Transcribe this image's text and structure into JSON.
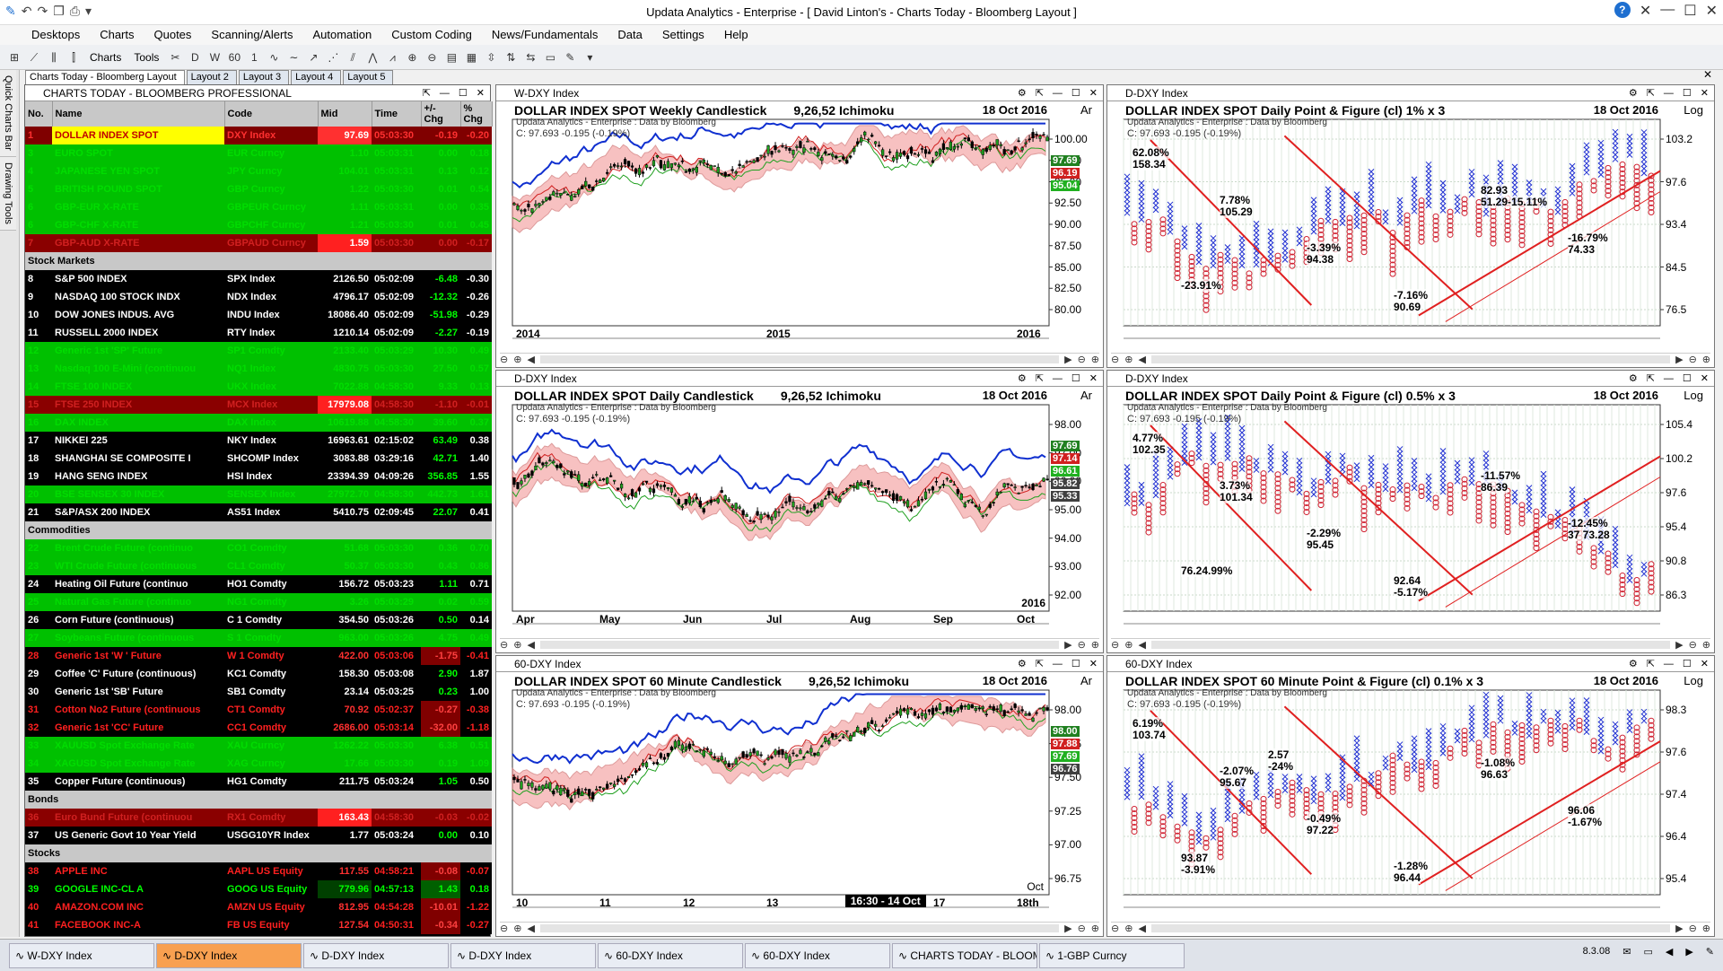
{
  "app": {
    "title": "Updata Analytics - Enterprise - [ David Linton's - Charts Today - Bloomberg Layout ]",
    "version": "8.3.08"
  },
  "menu": [
    "Desktops",
    "Charts",
    "Quotes",
    "Scanning/Alerts",
    "Automation",
    "Custom Coding",
    "News/Fundamentals",
    "Data",
    "Settings",
    "Help"
  ],
  "toolbar": {
    "charts_label": "Charts",
    "tools_label": "Tools"
  },
  "side_tabs": [
    "Quick Charts Bar",
    "Drawing Tools"
  ],
  "layout_tabs": [
    "Charts Today - Bloomberg Layout",
    "Layout 2",
    "Layout 3",
    "Layout 4",
    "Layout 5"
  ],
  "watchlist": {
    "title": "CHARTS TODAY - BLOOMBERG PROFESSIONAL",
    "columns": [
      "No.",
      "Name",
      "Code",
      "Mid",
      "Time",
      "+/- Chg",
      "% Chg"
    ],
    "rows": [
      {
        "style": "sel",
        "no": "1",
        "name": "DOLLAR INDEX SPOT",
        "code": "DXY Index",
        "mid": "97.69",
        "time": "05:03:30",
        "chg": "-0.19",
        "pct": "-0.20"
      },
      {
        "style": "g",
        "no": "3",
        "name": "EURO SPOT",
        "code": "EUR Curncy",
        "mid": "1.10",
        "time": "05:03:31",
        "chg": "0.00",
        "pct": "0.18"
      },
      {
        "style": "g",
        "no": "4",
        "name": "JAPANESE YEN SPOT",
        "code": "JPY Curncy",
        "mid": "104.01",
        "time": "05:03:31",
        "chg": "0.13",
        "pct": "0.12"
      },
      {
        "style": "g",
        "no": "5",
        "name": "BRITISH POUND SPOT",
        "code": "GBP Curncy",
        "mid": "1.22",
        "time": "05:03:30",
        "chg": "0.01",
        "pct": "0.54"
      },
      {
        "style": "g",
        "no": "6",
        "name": "GBP-EUR X-RATE",
        "code": "GBPEUR Curncy",
        "mid": "1.11",
        "time": "05:03:31",
        "chg": "0.00",
        "pct": "0.35"
      },
      {
        "style": "g",
        "no": "6",
        "name": "GBP-CHF X-RATE",
        "code": "GBPCHF Curncy",
        "mid": "1.21",
        "time": "05:03:30",
        "chg": "0.01",
        "pct": "0.45"
      },
      {
        "style": "r",
        "no": "7",
        "name": "GBP-AUD X-RATE",
        "code": "GBPAUD Curncy",
        "mid": "1.59",
        "time": "05:03:30",
        "chg": "0.00",
        "pct": "-0.17"
      },
      {
        "section": "Stock Markets"
      },
      {
        "style": "k",
        "no": "8",
        "name": "S&P 500 INDEX",
        "code": "SPX Index",
        "mid": "2126.50",
        "time": "05:02:09",
        "chg": "-6.48",
        "pct": "-0.30"
      },
      {
        "style": "k",
        "no": "9",
        "name": "NASDAQ 100 STOCK INDX",
        "code": "NDX Index",
        "mid": "4796.17",
        "time": "05:02:09",
        "chg": "-12.32",
        "pct": "-0.26"
      },
      {
        "style": "k",
        "no": "10",
        "name": "DOW JONES INDUS. AVG",
        "code": "INDU Index",
        "mid": "18086.40",
        "time": "05:02:09",
        "chg": "-51.98",
        "pct": "-0.29"
      },
      {
        "style": "k",
        "no": "11",
        "name": "RUSSELL 2000 INDEX",
        "code": "RTY Index",
        "mid": "1210.14",
        "time": "05:02:09",
        "chg": "-2.27",
        "pct": "-0.19"
      },
      {
        "style": "g",
        "no": "12",
        "name": "Generic 1st 'SP' Future",
        "code": "SP1 Comdty",
        "mid": "2133.40",
        "time": "05:03:29",
        "chg": "10.30",
        "pct": "0.49"
      },
      {
        "style": "g",
        "no": "13",
        "name": "Nasdaq 100 E-Mini (continuou",
        "code": "NQ1 Index",
        "mid": "4830.75",
        "time": "05:03:30",
        "chg": "27.50",
        "pct": "0.57"
      },
      {
        "style": "g",
        "no": "14",
        "name": "FTSE 100 INDEX",
        "code": "UKX Index",
        "mid": "7022.88",
        "time": "04:58:30",
        "chg": "9.33",
        "pct": "0.13"
      },
      {
        "style": "r",
        "no": "15",
        "name": "FTSE 250 INDEX",
        "code": "MCX Index",
        "mid": "17979.08",
        "time": "04:58:30",
        "chg": "-1.10",
        "pct": "-0.01"
      },
      {
        "style": "g",
        "no": "16",
        "name": "DAX INDEX",
        "code": "DAX Index",
        "mid": "10619.88",
        "time": "04:58:30",
        "chg": "39.60",
        "pct": "0.37"
      },
      {
        "style": "k",
        "no": "17",
        "name": "NIKKEI 225",
        "code": "NKY Index",
        "mid": "16963.61",
        "time": "02:15:02",
        "chg": "63.49",
        "pct": "0.38"
      },
      {
        "style": "k",
        "no": "18",
        "name": "SHANGHAI SE COMPOSITE I",
        "code": "SHCOMP Index",
        "mid": "3083.88",
        "time": "03:29:16",
        "chg": "42.71",
        "pct": "1.40"
      },
      {
        "style": "k",
        "no": "19",
        "name": "HANG SENG INDEX",
        "code": "HSI Index",
        "mid": "23394.39",
        "time": "04:09:26",
        "chg": "356.85",
        "pct": "1.55"
      },
      {
        "style": "g",
        "no": "20",
        "name": "BSE SENSEX 30 INDEX",
        "code": "SENSEX Index",
        "mid": "27972.70",
        "time": "04:58:30",
        "chg": "442.73",
        "pct": "1.61"
      },
      {
        "style": "k",
        "no": "21",
        "name": "S&P/ASX 200 INDEX",
        "code": "AS51 Index",
        "mid": "5410.75",
        "time": "02:09:45",
        "chg": "22.07",
        "pct": "0.41"
      },
      {
        "section": "Commodities"
      },
      {
        "style": "g",
        "no": "22",
        "name": "Brent Crude Future (continuo",
        "code": "CO1 Comdty",
        "mid": "51.68",
        "time": "05:03:30",
        "chg": "0.36",
        "pct": "0.70"
      },
      {
        "style": "g",
        "no": "23",
        "name": "WTI Crude Future (continuous",
        "code": "CL1 Comdty",
        "mid": "50.37",
        "time": "05:03:30",
        "chg": "0.43",
        "pct": "0.86"
      },
      {
        "style": "k",
        "no": "24",
        "name": "Heating Oil Future (continuo",
        "code": "HO1 Comdty",
        "mid": "156.72",
        "time": "05:03:23",
        "chg": "1.11",
        "pct": "0.71"
      },
      {
        "style": "g",
        "no": "25",
        "name": "Natural Gas Future (continuo",
        "code": "NG1 Comdty",
        "mid": "3.26",
        "time": "05:03:29",
        "chg": "0.02",
        "pct": "0.59"
      },
      {
        "style": "k",
        "no": "26",
        "name": "Corn Future (continuous)",
        "code": "C 1 Comdty",
        "mid": "354.50",
        "time": "05:03:26",
        "chg": "0.50",
        "pct": "0.14"
      },
      {
        "style": "g",
        "no": "27",
        "name": "Soybeans Future (continuous",
        "code": "S 1 Comdty",
        "mid": "963.00",
        "time": "05:03:26",
        "chg": "4.75",
        "pct": "0.49"
      },
      {
        "style": "kr",
        "no": "28",
        "name": "Generic 1st 'W ' Future",
        "code": "W 1 Comdty",
        "mid": "422.00",
        "time": "05:03:06",
        "chg": "-1.75",
        "pct": "-0.41"
      },
      {
        "style": "k",
        "no": "29",
        "name": "Coffee 'C' Future (continuous)",
        "code": "KC1 Comdty",
        "mid": "158.30",
        "time": "05:03:08",
        "chg": "2.90",
        "pct": "1.87"
      },
      {
        "style": "k",
        "no": "30",
        "name": "Generic 1st 'SB' Future",
        "code": "SB1 Comdty",
        "mid": "23.14",
        "time": "05:03:25",
        "chg": "0.23",
        "pct": "1.00"
      },
      {
        "style": "kr",
        "no": "31",
        "name": "Cotton No2 Future (continuous",
        "code": "CT1 Comdty",
        "mid": "70.92",
        "time": "05:02:37",
        "chg": "-0.27",
        "pct": "-0.38"
      },
      {
        "style": "kr",
        "no": "32",
        "name": "Generic 1st 'CC' Future",
        "code": "CC1 Comdty",
        "mid": "2686.00",
        "time": "05:03:14",
        "chg": "-32.00",
        "pct": "-1.18"
      },
      {
        "style": "g",
        "no": "33",
        "name": "XAUUSD Spot Exchange Rate",
        "code": "XAU Curncy",
        "mid": "1262.22",
        "time": "05:03:30",
        "chg": "6.38",
        "pct": "0.51"
      },
      {
        "style": "g",
        "no": "34",
        "name": "XAGUSD Spot Exchange Rate",
        "code": "XAG Curncy",
        "mid": "17.66",
        "time": "05:03:30",
        "chg": "0.19",
        "pct": "1.09"
      },
      {
        "style": "k",
        "no": "35",
        "name": "Copper Future (continuous)",
        "code": "HG1 Comdty",
        "mid": "211.75",
        "time": "05:03:24",
        "chg": "1.05",
        "pct": "0.50"
      },
      {
        "section": "Bonds"
      },
      {
        "style": "r",
        "no": "36",
        "name": "Euro Bund Future (continuou",
        "code": "RX1 Comdty",
        "mid": "163.43",
        "time": "04:58:30",
        "chg": "-0.03",
        "pct": "-0.02"
      },
      {
        "style": "k",
        "no": "37",
        "name": "US Generic Govt 10 Year Yield",
        "code": "USGG10YR Index",
        "mid": "1.77",
        "time": "05:03:24",
        "chg": "0.00",
        "pct": "0.10"
      },
      {
        "section": "Stocks"
      },
      {
        "style": "kr",
        "no": "38",
        "name": "APPLE INC",
        "code": "AAPL US Equity",
        "mid": "117.55",
        "time": "04:58:21",
        "chg": "-0.08",
        "pct": "-0.07"
      },
      {
        "style": "kg",
        "no": "39",
        "name": "GOOGLE INC-CL A",
        "code": "GOOG US Equity",
        "mid": "779.96",
        "time": "04:57:13",
        "chg": "1.43",
        "pct": "0.18"
      },
      {
        "style": "kr",
        "no": "40",
        "name": "AMAZON.COM INC",
        "code": "AMZN US Equity",
        "mid": "812.95",
        "time": "04:54:28",
        "chg": "-10.01",
        "pct": "-1.22"
      },
      {
        "style": "kr",
        "no": "41",
        "name": "FACEBOOK INC-A",
        "code": "FB US Equity",
        "mid": "127.54",
        "time": "04:50:31",
        "chg": "-0.34",
        "pct": "-0.27"
      }
    ]
  },
  "charts": {
    "c1": {
      "tab": "W-DXY Index",
      "title": "DOLLAR INDEX SPOT Weekly Candlestick",
      "params": "9,26,52 Ichimoku",
      "date": "18 Oct 2016",
      "scale": "Ar",
      "source": "Updata Analytics - Enterprise : Data by Bloomberg",
      "close": "C: 97.693  -0.195 (-0.19%)",
      "yticks": [
        "100.00",
        "97.50",
        "95.00",
        "92.50",
        "90.00",
        "87.50",
        "85.00",
        "82.50",
        "80.00"
      ],
      "xticks": [
        "2014",
        "2015",
        "2016"
      ],
      "tags": [
        "97.69",
        "96.19",
        "95.04"
      ]
    },
    "c2": {
      "tab": "D-DXY Index",
      "title": "DOLLAR INDEX SPOT Daily Candlestick",
      "params": "9,26,52 Ichimoku",
      "date": "18 Oct 2016",
      "scale": "Ar",
      "source": "Updata Analytics - Enterprise : Data by Bloomberg",
      "close": "C: 97.693  -0.195 (-0.19%)",
      "yticks": [
        "98.00",
        "97.00",
        "96.00",
        "95.00",
        "94.00",
        "93.00",
        "92.00"
      ],
      "xticks": [
        "Apr",
        "May",
        "Jun",
        "Jul",
        "Aug",
        "Sep",
        "Oct"
      ],
      "year": "2016",
      "tags": [
        "97.69",
        "97.14",
        "96.61",
        "95.82",
        "95.33"
      ]
    },
    "c3": {
      "tab": "60-DXY Index",
      "title": "DOLLAR INDEX SPOT 60 Minute Candlestick",
      "params": "9,26,52 Ichimoku",
      "date": "18 Oct 2016",
      "scale": "Ar",
      "source": "Updata Analytics - Enterprise : Data by Bloomberg",
      "close": "C: 97.693  -0.195 (-0.19%)",
      "yticks": [
        "98.00",
        "97.75",
        "97.50",
        "97.25",
        "97.00",
        "96.75"
      ],
      "xticks": [
        "10",
        "11",
        "12",
        "13",
        "14",
        "17",
        "18th"
      ],
      "month": "Oct",
      "cursor": "16:30 - 14 Oct",
      "tags": [
        "98.00",
        "97.88",
        "97.69",
        "96.76"
      ]
    },
    "c4": {
      "tab": "D-DXY Index",
      "title": "DOLLAR INDEX SPOT Daily Point & Figure (cl) 1% x 3",
      "date": "18 Oct 2016",
      "scale": "Log",
      "source": "Updata Analytics - Enterprise : Data by Bloomberg",
      "close": "C: 97.693  -0.195 (-0.19%)",
      "yticks": [
        "103.2",
        "97.6",
        "93.4",
        "84.5",
        "76.5"
      ],
      "labels": [
        "62.08%",
        "158.34",
        "7.78%",
        "105.29",
        "-3.39%",
        "94.38",
        "-7.16%",
        "90.69",
        "82.93",
        "51.29-15.11%",
        "-16.79%",
        "74.33",
        "-23.91%"
      ]
    },
    "c5": {
      "tab": "D-DXY Index",
      "title": "DOLLAR INDEX SPOT Daily Point & Figure (cl) 0.5% x 3",
      "date": "18 Oct 2016",
      "scale": "Log",
      "source": "Updata Analytics - Enterprise : Data by Bloomberg",
      "close": "C: 97.693  -0.195 (-0.19%)",
      "yticks": [
        "105.4",
        "100.2",
        "97.6",
        "95.4",
        "90.8",
        "86.3"
      ],
      "labels": [
        "4.77%",
        "102.35",
        "3.73%",
        "101.34",
        "-2.29%",
        "95.45",
        "92.64",
        "-5.17%",
        "-11.57%",
        "86.39",
        "-12.45%",
        "37 73.28",
        "76.24.99%"
      ]
    },
    "c6": {
      "tab": "60-DXY Index",
      "title": "DOLLAR INDEX SPOT 60 Minute Point & Figure (cl) 0.1% x 3",
      "date": "18 Oct 2016",
      "scale": "Log",
      "source": "Updata Analytics - Enterprise : Data by Bloomberg",
      "close": "C: 97.693  -0.195 (-0.19%)",
      "yticks": [
        "98.3",
        "97.6",
        "97.4",
        "96.4",
        "95.4"
      ],
      "labels": [
        "6.19%",
        "103.74",
        "-2.07%",
        "95.67",
        "-0.49%",
        "97.22",
        "-1.28%",
        "96.44",
        "-1.08%",
        "96.63",
        "96.06",
        "-1.67%",
        "93.87",
        "-3.91%",
        "2.57",
        "-24%"
      ]
    }
  },
  "taskbar": [
    "W-DXY Index",
    "D-DXY Index",
    "D-DXY Index",
    "D-DXY Index",
    "60-DXY Index",
    "60-DXY Index",
    "CHARTS TODAY - BLOOM",
    "1-GBP Curncy"
  ]
}
